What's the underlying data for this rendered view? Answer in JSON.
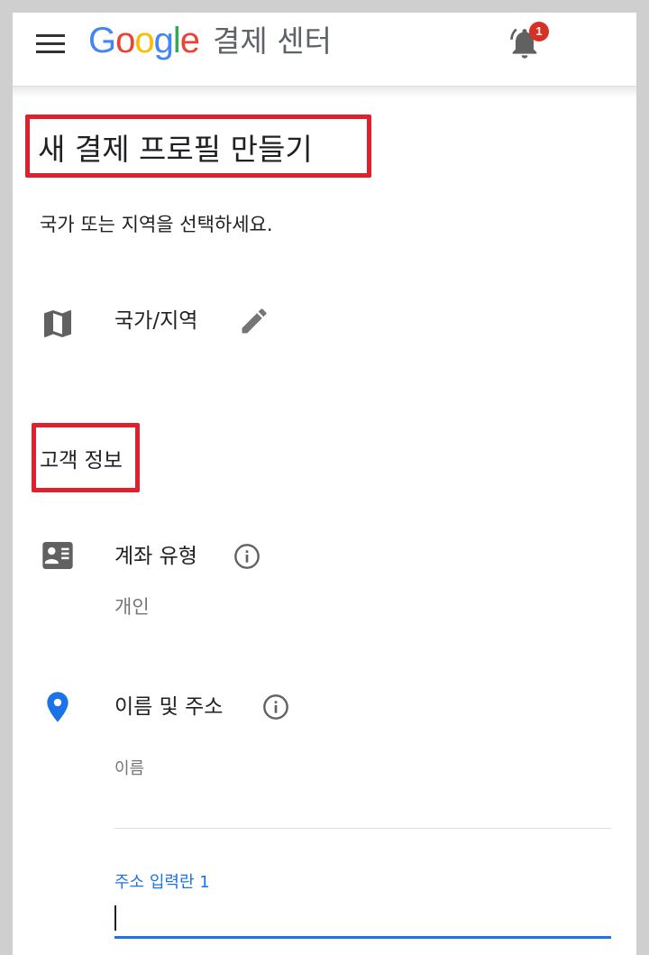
{
  "header": {
    "logo_letters": [
      {
        "char": "G",
        "color": "#4285F4"
      },
      {
        "char": "o",
        "color": "#EA4335"
      },
      {
        "char": "o",
        "color": "#FBBC05"
      },
      {
        "char": "g",
        "color": "#4285F4"
      },
      {
        "char": "l",
        "color": "#34A853"
      },
      {
        "char": "e",
        "color": "#EA4335"
      }
    ],
    "product_name": "결제 센터",
    "notification_count": "1",
    "icons": {
      "menu": "hamburger-menu-icon",
      "notifications": "bell-icon"
    }
  },
  "form": {
    "title": "새 결제 프로필 만들기",
    "instruction": "국가 또는 지역을 선택하세요.",
    "country_row": {
      "label": "국가/지역",
      "icon": "map-icon",
      "action_icon": "pencil-edit-icon"
    },
    "section_heading": "고객 정보",
    "account_type": {
      "label": "계좌 유형",
      "value": "개인",
      "icon": "contact-card-icon",
      "info_icon": "info-icon"
    },
    "name_address": {
      "label": "이름 및 주소",
      "icon": "location-pin-icon",
      "info_icon": "info-icon"
    },
    "name_field": {
      "label": "이름",
      "value": ""
    },
    "address_line1": {
      "label": "주소 입력란 1",
      "value": ""
    }
  },
  "colors": {
    "accent": "#1a73e8",
    "highlight_box": "#e0202c",
    "badge": "#d93025",
    "pin": "#1a73e8",
    "icon_gray": "#616161"
  }
}
